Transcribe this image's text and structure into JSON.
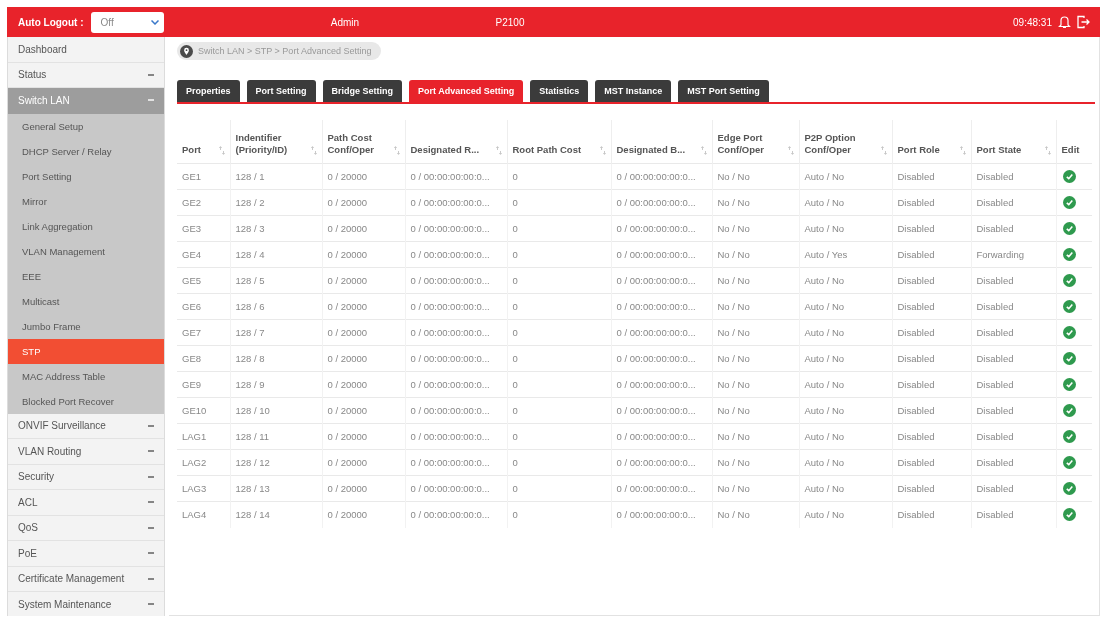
{
  "header": {
    "auto_logout": {
      "label": "Auto Logout :",
      "value": "Off"
    },
    "user": "Admin",
    "model": "P2100",
    "time": "09:48:31"
  },
  "sidebar": {
    "items": [
      {
        "label": "Dashboard",
        "kind": "link",
        "expanded": false,
        "selected": false
      },
      {
        "label": "Status",
        "kind": "group",
        "expanded": false,
        "selected": false
      },
      {
        "label": "Switch LAN",
        "kind": "group",
        "expanded": true,
        "selected": false,
        "children": [
          {
            "label": "General Setup",
            "selected": false
          },
          {
            "label": "DHCP Server / Relay",
            "selected": false
          },
          {
            "label": "Port Setting",
            "selected": false
          },
          {
            "label": "Mirror",
            "selected": false
          },
          {
            "label": "Link Aggregation",
            "selected": false
          },
          {
            "label": "VLAN Management",
            "selected": false
          },
          {
            "label": "EEE",
            "selected": false
          },
          {
            "label": "Multicast",
            "selected": false
          },
          {
            "label": "Jumbo Frame",
            "selected": false
          },
          {
            "label": "STP",
            "selected": true
          },
          {
            "label": "MAC Address Table",
            "selected": false
          },
          {
            "label": "Blocked Port Recover",
            "selected": false
          }
        ]
      },
      {
        "label": "ONVIF Surveillance",
        "kind": "group",
        "expanded": false,
        "selected": false
      },
      {
        "label": "VLAN Routing",
        "kind": "group",
        "expanded": false,
        "selected": false
      },
      {
        "label": "Security",
        "kind": "group",
        "expanded": false,
        "selected": false
      },
      {
        "label": "ACL",
        "kind": "group",
        "expanded": false,
        "selected": false
      },
      {
        "label": "QoS",
        "kind": "group",
        "expanded": false,
        "selected": false
      },
      {
        "label": "PoE",
        "kind": "group",
        "expanded": false,
        "selected": false
      },
      {
        "label": "Certificate Management",
        "kind": "group",
        "expanded": false,
        "selected": false
      },
      {
        "label": "System Maintenance",
        "kind": "group",
        "expanded": false,
        "selected": false
      }
    ]
  },
  "breadcrumb": "Switch LAN > STP > Port Advanced Setting",
  "tabs": [
    {
      "label": "Properties",
      "selected": false
    },
    {
      "label": "Port Setting",
      "selected": false
    },
    {
      "label": "Bridge Setting",
      "selected": false
    },
    {
      "label": "Port Advanced Setting",
      "selected": true
    },
    {
      "label": "Statistics",
      "selected": false
    },
    {
      "label": "MST Instance",
      "selected": false
    },
    {
      "label": "MST Port Setting",
      "selected": false
    }
  ],
  "table": {
    "columns": [
      {
        "label": "Port",
        "sortable": true
      },
      {
        "label": "Indentifier\n(Priority/ID)",
        "sortable": true
      },
      {
        "label": "Path Cost\nConf/Oper",
        "sortable": true
      },
      {
        "label": "Designated R...",
        "sortable": true
      },
      {
        "label": "Root Path Cost",
        "sortable": true
      },
      {
        "label": "Designated B...",
        "sortable": true
      },
      {
        "label": "Edge Port\nConf/Oper",
        "sortable": true
      },
      {
        "label": "P2P Option\nConf/Oper",
        "sortable": true
      },
      {
        "label": "Port Role",
        "sortable": true
      },
      {
        "label": "Port State",
        "sortable": true
      },
      {
        "label": "Edit",
        "sortable": false
      }
    ],
    "rows": [
      {
        "cells": [
          "GE1",
          "128 / 1",
          "0 / 20000",
          "0 / 00:00:00:00:0...",
          "0",
          "0 / 00:00:00:00:0...",
          "No / No",
          "Auto / No",
          "Disabled",
          "Disabled"
        ]
      },
      {
        "cells": [
          "GE2",
          "128 / 2",
          "0 / 20000",
          "0 / 00:00:00:00:0...",
          "0",
          "0 / 00:00:00:00:0...",
          "No / No",
          "Auto / No",
          "Disabled",
          "Disabled"
        ]
      },
      {
        "cells": [
          "GE3",
          "128 / 3",
          "0 / 20000",
          "0 / 00:00:00:00:0...",
          "0",
          "0 / 00:00:00:00:0...",
          "No / No",
          "Auto / No",
          "Disabled",
          "Disabled"
        ]
      },
      {
        "cells": [
          "GE4",
          "128 / 4",
          "0 / 20000",
          "0 / 00:00:00:00:0...",
          "0",
          "0 / 00:00:00:00:0...",
          "No / No",
          "Auto / Yes",
          "Disabled",
          "Forwarding"
        ]
      },
      {
        "cells": [
          "GE5",
          "128 / 5",
          "0 / 20000",
          "0 / 00:00:00:00:0...",
          "0",
          "0 / 00:00:00:00:0...",
          "No / No",
          "Auto / No",
          "Disabled",
          "Disabled"
        ]
      },
      {
        "cells": [
          "GE6",
          "128 / 6",
          "0 / 20000",
          "0 / 00:00:00:00:0...",
          "0",
          "0 / 00:00:00:00:0...",
          "No / No",
          "Auto / No",
          "Disabled",
          "Disabled"
        ]
      },
      {
        "cells": [
          "GE7",
          "128 / 7",
          "0 / 20000",
          "0 / 00:00:00:00:0...",
          "0",
          "0 / 00:00:00:00:0...",
          "No / No",
          "Auto / No",
          "Disabled",
          "Disabled"
        ]
      },
      {
        "cells": [
          "GE8",
          "128 / 8",
          "0 / 20000",
          "0 / 00:00:00:00:0...",
          "0",
          "0 / 00:00:00:00:0...",
          "No / No",
          "Auto / No",
          "Disabled",
          "Disabled"
        ]
      },
      {
        "cells": [
          "GE9",
          "128 / 9",
          "0 / 20000",
          "0 / 00:00:00:00:0...",
          "0",
          "0 / 00:00:00:00:0...",
          "No / No",
          "Auto / No",
          "Disabled",
          "Disabled"
        ]
      },
      {
        "cells": [
          "GE10",
          "128 / 10",
          "0 / 20000",
          "0 / 00:00:00:00:0...",
          "0",
          "0 / 00:00:00:00:0...",
          "No / No",
          "Auto / No",
          "Disabled",
          "Disabled"
        ]
      },
      {
        "cells": [
          "LAG1",
          "128 / 11",
          "0 / 20000",
          "0 / 00:00:00:00:0...",
          "0",
          "0 / 00:00:00:00:0...",
          "No / No",
          "Auto / No",
          "Disabled",
          "Disabled"
        ]
      },
      {
        "cells": [
          "LAG2",
          "128 / 12",
          "0 / 20000",
          "0 / 00:00:00:00:0...",
          "0",
          "0 / 00:00:00:00:0...",
          "No / No",
          "Auto / No",
          "Disabled",
          "Disabled"
        ]
      },
      {
        "cells": [
          "LAG3",
          "128 / 13",
          "0 / 20000",
          "0 / 00:00:00:00:0...",
          "0",
          "0 / 00:00:00:00:0...",
          "No / No",
          "Auto / No",
          "Disabled",
          "Disabled"
        ]
      },
      {
        "cells": [
          "LAG4",
          "128 / 14",
          "0 / 20000",
          "0 / 00:00:00:00:0...",
          "0",
          "0 / 00:00:00:00:0...",
          "No / No",
          "Auto / No",
          "Disabled",
          "Disabled"
        ]
      }
    ]
  }
}
